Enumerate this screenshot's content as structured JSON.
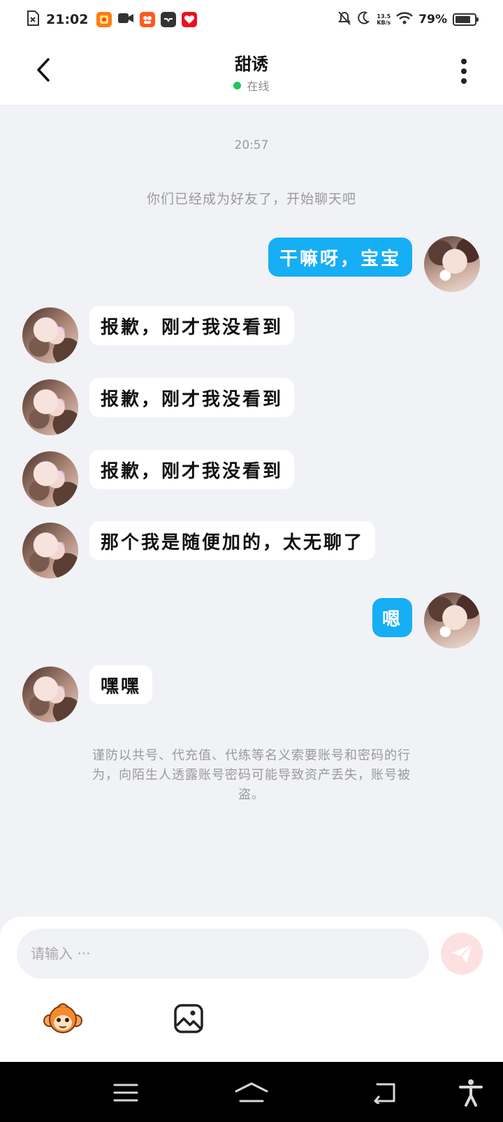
{
  "status_bar": {
    "time": "21:02",
    "net_speed_value": "13.5",
    "net_speed_unit": "KB/s",
    "battery": "79%",
    "battery_level": 0.79,
    "icons": [
      "file-error-icon",
      "app-icon-1",
      "video-camera-icon",
      "app-icon-2",
      "inbox-icon",
      "app-icon-3",
      "silent-bell-icon",
      "moon-icon",
      "wifi-icon",
      "battery-icon"
    ]
  },
  "header": {
    "title": "甜诱",
    "status": "在线"
  },
  "chat": {
    "timestamp": "20:57",
    "system_note": "你们已经成为好友了，开始聊天吧",
    "messages": [
      {
        "side": "out",
        "text": "干嘛呀，宝宝"
      },
      {
        "side": "in",
        "text": "报歉，刚才我没看到"
      },
      {
        "side": "in",
        "text": "报歉，刚才我没看到"
      },
      {
        "side": "in",
        "text": "报歉，刚才我没看到"
      },
      {
        "side": "in",
        "text": "那个我是随便加的，太无聊了"
      },
      {
        "side": "out",
        "text": "嗯"
      },
      {
        "side": "in",
        "text": "嘿嘿"
      }
    ],
    "warning_lines": [
      "谨防以共号、代充值、代练等名义索要账号和密码的行",
      "为，向陌生人透露账号密码可能导致资产丢失，账号被",
      "盗。"
    ]
  },
  "composer": {
    "placeholder": "请输入 ···",
    "value": ""
  },
  "colors": {
    "accent_blue": "#16aef4",
    "online_green": "#21c35a",
    "send_disabled": "#fde1e1",
    "background": "#f1f2f6"
  }
}
